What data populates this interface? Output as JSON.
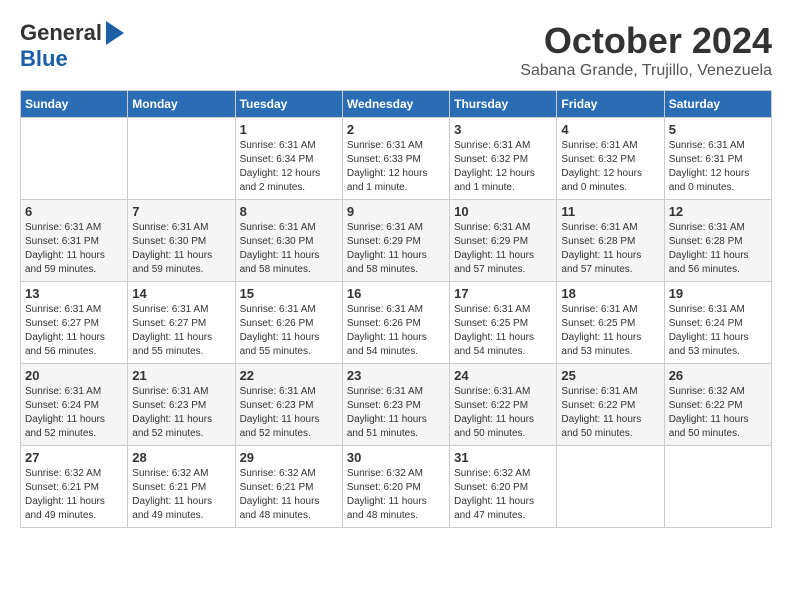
{
  "logo": {
    "general": "General",
    "blue": "Blue"
  },
  "title": "October 2024",
  "location": "Sabana Grande, Trujillo, Venezuela",
  "headers": [
    "Sunday",
    "Monday",
    "Tuesday",
    "Wednesday",
    "Thursday",
    "Friday",
    "Saturday"
  ],
  "weeks": [
    [
      {
        "day": "",
        "info": ""
      },
      {
        "day": "",
        "info": ""
      },
      {
        "day": "1",
        "info": "Sunrise: 6:31 AM\nSunset: 6:34 PM\nDaylight: 12 hours\nand 2 minutes."
      },
      {
        "day": "2",
        "info": "Sunrise: 6:31 AM\nSunset: 6:33 PM\nDaylight: 12 hours\nand 1 minute."
      },
      {
        "day": "3",
        "info": "Sunrise: 6:31 AM\nSunset: 6:32 PM\nDaylight: 12 hours\nand 1 minute."
      },
      {
        "day": "4",
        "info": "Sunrise: 6:31 AM\nSunset: 6:32 PM\nDaylight: 12 hours\nand 0 minutes."
      },
      {
        "day": "5",
        "info": "Sunrise: 6:31 AM\nSunset: 6:31 PM\nDaylight: 12 hours\nand 0 minutes."
      }
    ],
    [
      {
        "day": "6",
        "info": "Sunrise: 6:31 AM\nSunset: 6:31 PM\nDaylight: 11 hours\nand 59 minutes."
      },
      {
        "day": "7",
        "info": "Sunrise: 6:31 AM\nSunset: 6:30 PM\nDaylight: 11 hours\nand 59 minutes."
      },
      {
        "day": "8",
        "info": "Sunrise: 6:31 AM\nSunset: 6:30 PM\nDaylight: 11 hours\nand 58 minutes."
      },
      {
        "day": "9",
        "info": "Sunrise: 6:31 AM\nSunset: 6:29 PM\nDaylight: 11 hours\nand 58 minutes."
      },
      {
        "day": "10",
        "info": "Sunrise: 6:31 AM\nSunset: 6:29 PM\nDaylight: 11 hours\nand 57 minutes."
      },
      {
        "day": "11",
        "info": "Sunrise: 6:31 AM\nSunset: 6:28 PM\nDaylight: 11 hours\nand 57 minutes."
      },
      {
        "day": "12",
        "info": "Sunrise: 6:31 AM\nSunset: 6:28 PM\nDaylight: 11 hours\nand 56 minutes."
      }
    ],
    [
      {
        "day": "13",
        "info": "Sunrise: 6:31 AM\nSunset: 6:27 PM\nDaylight: 11 hours\nand 56 minutes."
      },
      {
        "day": "14",
        "info": "Sunrise: 6:31 AM\nSunset: 6:27 PM\nDaylight: 11 hours\nand 55 minutes."
      },
      {
        "day": "15",
        "info": "Sunrise: 6:31 AM\nSunset: 6:26 PM\nDaylight: 11 hours\nand 55 minutes."
      },
      {
        "day": "16",
        "info": "Sunrise: 6:31 AM\nSunset: 6:26 PM\nDaylight: 11 hours\nand 54 minutes."
      },
      {
        "day": "17",
        "info": "Sunrise: 6:31 AM\nSunset: 6:25 PM\nDaylight: 11 hours\nand 54 minutes."
      },
      {
        "day": "18",
        "info": "Sunrise: 6:31 AM\nSunset: 6:25 PM\nDaylight: 11 hours\nand 53 minutes."
      },
      {
        "day": "19",
        "info": "Sunrise: 6:31 AM\nSunset: 6:24 PM\nDaylight: 11 hours\nand 53 minutes."
      }
    ],
    [
      {
        "day": "20",
        "info": "Sunrise: 6:31 AM\nSunset: 6:24 PM\nDaylight: 11 hours\nand 52 minutes."
      },
      {
        "day": "21",
        "info": "Sunrise: 6:31 AM\nSunset: 6:23 PM\nDaylight: 11 hours\nand 52 minutes."
      },
      {
        "day": "22",
        "info": "Sunrise: 6:31 AM\nSunset: 6:23 PM\nDaylight: 11 hours\nand 52 minutes."
      },
      {
        "day": "23",
        "info": "Sunrise: 6:31 AM\nSunset: 6:23 PM\nDaylight: 11 hours\nand 51 minutes."
      },
      {
        "day": "24",
        "info": "Sunrise: 6:31 AM\nSunset: 6:22 PM\nDaylight: 11 hours\nand 50 minutes."
      },
      {
        "day": "25",
        "info": "Sunrise: 6:31 AM\nSunset: 6:22 PM\nDaylight: 11 hours\nand 50 minutes."
      },
      {
        "day": "26",
        "info": "Sunrise: 6:32 AM\nSunset: 6:22 PM\nDaylight: 11 hours\nand 50 minutes."
      }
    ],
    [
      {
        "day": "27",
        "info": "Sunrise: 6:32 AM\nSunset: 6:21 PM\nDaylight: 11 hours\nand 49 minutes."
      },
      {
        "day": "28",
        "info": "Sunrise: 6:32 AM\nSunset: 6:21 PM\nDaylight: 11 hours\nand 49 minutes."
      },
      {
        "day": "29",
        "info": "Sunrise: 6:32 AM\nSunset: 6:21 PM\nDaylight: 11 hours\nand 48 minutes."
      },
      {
        "day": "30",
        "info": "Sunrise: 6:32 AM\nSunset: 6:20 PM\nDaylight: 11 hours\nand 48 minutes."
      },
      {
        "day": "31",
        "info": "Sunrise: 6:32 AM\nSunset: 6:20 PM\nDaylight: 11 hours\nand 47 minutes."
      },
      {
        "day": "",
        "info": ""
      },
      {
        "day": "",
        "info": ""
      }
    ]
  ]
}
